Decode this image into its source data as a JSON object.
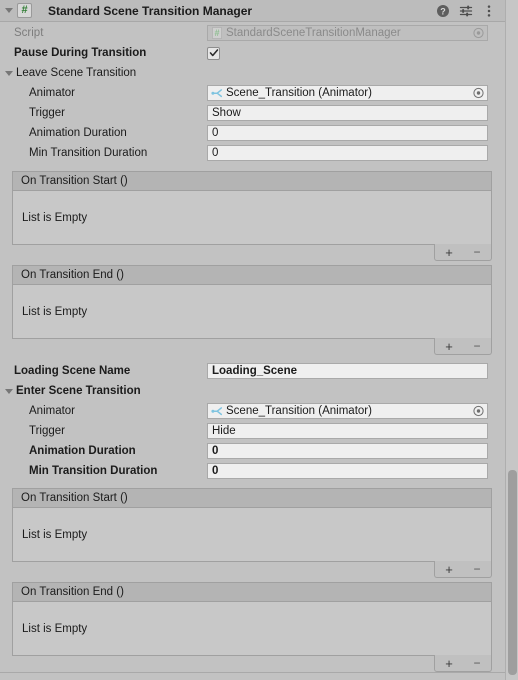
{
  "window": {
    "title": "Standard Scene Transition Manager",
    "foldout_icon": "triangle-down-icon",
    "script_badge_glyph": "#",
    "help_icon": "help-icon",
    "preset_icon": "preset-settings-icon",
    "menu_icon": "kebab-menu-icon"
  },
  "script_row": {
    "label": "Script",
    "value": "StandardSceneTransitionManager",
    "icon": "cs-script-icon",
    "picker_icon": "object-picker-icon"
  },
  "pause_row": {
    "label": "Pause During Transition",
    "checked": true,
    "check_glyph": "✔"
  },
  "leave_section": {
    "label": "Leave Scene Transition",
    "animator": {
      "label": "Animator",
      "value": "Scene_Transition (Animator)",
      "icon": "animator-bone-icon",
      "picker_icon": "object-picker-icon"
    },
    "trigger": {
      "label": "Trigger",
      "value": "Show"
    },
    "animation_duration": {
      "label": "Animation Duration",
      "value": "0"
    },
    "min_transition_duration": {
      "label": "Min Transition Duration",
      "value": "0"
    },
    "on_start": {
      "header": "On Transition Start ()",
      "empty_text": "List is Empty",
      "add_label": "+",
      "remove_label": "−"
    },
    "on_end": {
      "header": "On Transition End ()",
      "empty_text": "List is Empty",
      "add_label": "+",
      "remove_label": "−"
    }
  },
  "loading_scene_row": {
    "label": "Loading Scene Name",
    "value": "Loading_Scene"
  },
  "enter_section": {
    "label": "Enter Scene Transition",
    "animator": {
      "label": "Animator",
      "value": "Scene_Transition (Animator)",
      "icon": "animator-bone-icon",
      "picker_icon": "object-picker-icon"
    },
    "trigger": {
      "label": "Trigger",
      "value": "Hide"
    },
    "animation_duration": {
      "label": "Animation Duration",
      "value": "0"
    },
    "min_transition_duration": {
      "label": "Min Transition Duration",
      "value": "0"
    },
    "on_start": {
      "header": "On Transition Start ()",
      "empty_text": "List is Empty",
      "add_label": "+",
      "remove_label": "−"
    },
    "on_end": {
      "header": "On Transition End ()",
      "empty_text": "List is Empty",
      "add_label": "+",
      "remove_label": "−"
    }
  },
  "colors": {
    "panel_bg": "#c2c2c2",
    "header_bg": "#bcbcbc",
    "field_bg": "#efefef",
    "field_border": "#a9a9a9",
    "event_header_bg": "#b4b4b4",
    "event_body_bg": "#c8c8c8",
    "script_icon_green": "#2e7d32",
    "animator_icon_blue": "#7fc4e0",
    "text": "#1b1b1b",
    "text_dim": "#7d7d7d",
    "scroll_thumb": "#9e9e9e"
  }
}
